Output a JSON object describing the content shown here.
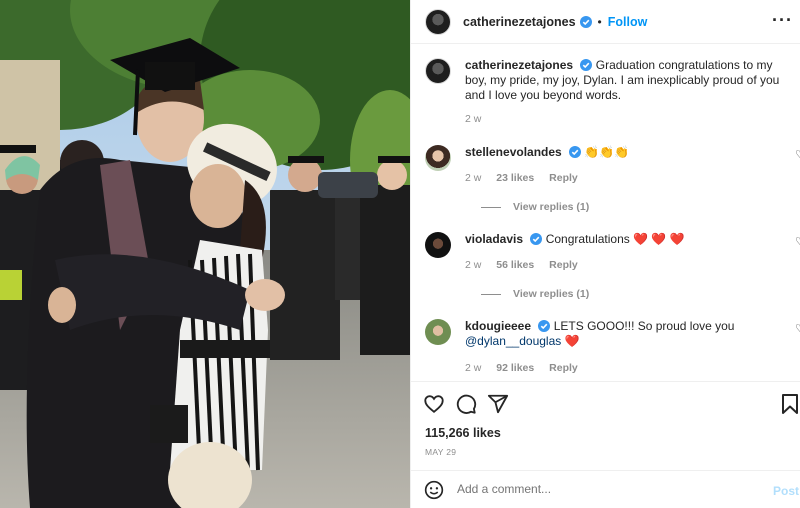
{
  "post": {
    "photo_alt": "Graduation photo",
    "author": {
      "username": "catherinezetajones",
      "verified": true,
      "separator": "•",
      "follow_label": "Follow"
    },
    "more_label": "···",
    "caption": {
      "username": "catherinezetajones",
      "text": "Graduation congratulations to my boy, my pride, my joy, Dylan. I am inexplicably proud of you and I love you beyond words.",
      "time": "2 w"
    },
    "comments": [
      {
        "username": "stellenevolandes",
        "verified": true,
        "text": "👏👏👏",
        "time": "2 w",
        "likes": "23 likes",
        "reply_label": "Reply",
        "view_replies": "View replies (1)"
      },
      {
        "username": "violadavis",
        "verified": true,
        "text": "Congratulations ❤️ ❤️ ❤️",
        "time": "2 w",
        "likes": "56 likes",
        "reply_label": "Reply",
        "view_replies": "View replies (1)"
      },
      {
        "username": "kdougieeee",
        "verified": true,
        "text": "LETS GOOO!!! So proud love you",
        "mention": "@dylan__douglas",
        "text_end": " ❤️",
        "time": "2 w",
        "likes": "92 likes",
        "reply_label": "Reply"
      }
    ],
    "like_count": "115,266 likes",
    "date": "MAY 29",
    "add_comment_placeholder": "Add a comment...",
    "post_label": "Post"
  },
  "icons": {
    "heart": "heart-icon",
    "comment": "comment-icon",
    "share": "share-icon",
    "save": "bookmark-icon",
    "emoji": "emoji-icon",
    "verified": "verified-badge-icon"
  },
  "colors": {
    "accent": "#0095f6",
    "verified": "#3897f0",
    "muted": "#8e8e8e",
    "text": "#262626",
    "post_disabled": "#b2dffc",
    "heart_red": "#ed4956"
  }
}
